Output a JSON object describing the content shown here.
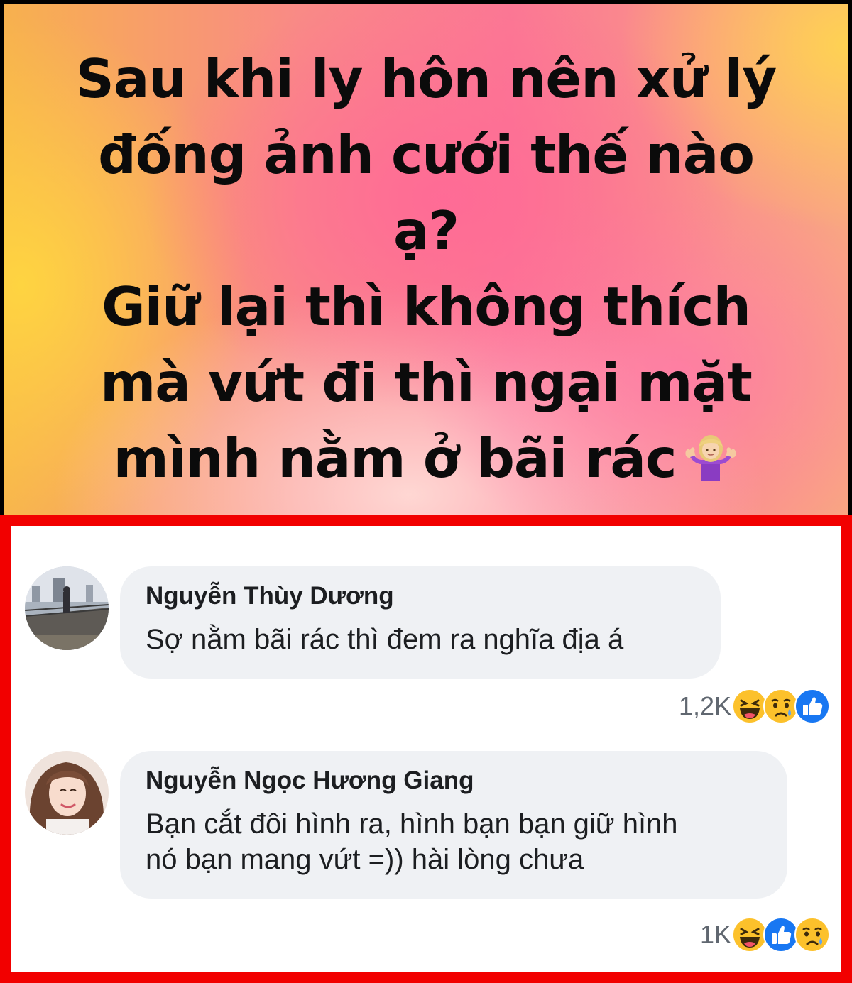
{
  "post": {
    "lines": [
      "Sau khi ly hôn nên xử lý",
      "đống ảnh cưới thế nào",
      "ạ?",
      "Giữ lại thì không thích",
      "mà vứt đi thì ngại mặt",
      "mình nằm ở bãi rác"
    ],
    "trailing_emoji": "person-shrugging-icon"
  },
  "comments": [
    {
      "author": "Nguyễn Thùy Dương",
      "text_lines": [
        "Sợ nằm bãi rác thì đem ra nghĩa địa á"
      ],
      "reaction_count": "1,2K",
      "reactions": [
        "haha-icon",
        "sad-icon",
        "like-icon"
      ]
    },
    {
      "author": "Nguyễn Ngọc Hương Giang",
      "text_lines": [
        "Bạn cắt đôi hình ra, hình bạn bạn giữ hình",
        "nó bạn mang vứt =)) hài lòng chưa"
      ],
      "reaction_count": "1K",
      "reactions": [
        "haha-icon",
        "like-icon",
        "sad-icon"
      ]
    }
  ],
  "colors": {
    "highlight_border": "#f20000",
    "bubble_bg": "#eff1f4",
    "like_blue": "#1877f2",
    "emoji_yellow": "#fcc12b"
  }
}
